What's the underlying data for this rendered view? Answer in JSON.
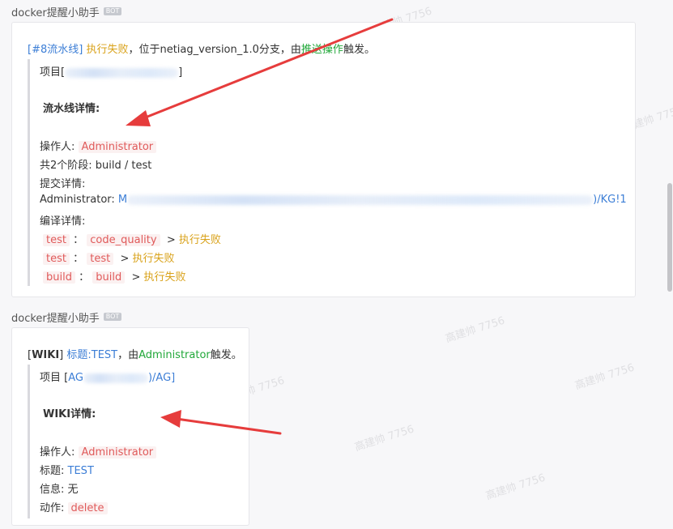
{
  "messages": [
    {
      "sender": "docker提醒小助手",
      "bot_tag": "BOT",
      "header": {
        "link": "[#8流水线]",
        "status": "执行失败",
        "text1": "，位于netiag_version_1.0分支，由",
        "trigger": "推送操作",
        "text2": "触发。"
      },
      "project_label": "项目",
      "project_bracket_open": "[",
      "project_visible_tail": "]",
      "section_title": "流水线详情:",
      "operator_label": "操作人:",
      "operator_value": "Administrator",
      "stages_text": "共2个阶段: build / test",
      "commit_label": "提交详情:",
      "commit_author": "Administrator:",
      "commit_head": "M",
      "commit_tail": ")/KG!1",
      "compile_label": "编译详情:",
      "compile_rows": [
        {
          "stage": "test",
          "sep": "：",
          "job": "code_quality",
          "arrow": ">",
          "result": "执行失败"
        },
        {
          "stage": "test",
          "sep": "：",
          "job": "test",
          "arrow": ">",
          "result": "执行失败"
        },
        {
          "stage": "build",
          "sep": "：",
          "job": "build",
          "arrow": ">",
          "result": "执行失败"
        }
      ]
    },
    {
      "sender": "docker提醒小助手",
      "bot_tag": "BOT",
      "header": {
        "open": "[",
        "tag": "WIKI",
        "close": "]",
        "title_link": "标题:TEST",
        "text1": "，由",
        "author": "Administrator",
        "text2": "触发。"
      },
      "project_label": "项目",
      "project_bracket_open": "[",
      "project_head": "AG",
      "project_tail": ")/AG]",
      "section_title": "WIKI详情:",
      "operator_label": "操作人:",
      "operator_value": "Administrator",
      "title_label": "标题:",
      "title_value": "TEST",
      "info_label": "信息:",
      "info_value": "无",
      "action_label": "动作:",
      "action_value": "delete"
    }
  ],
  "watermark_text": "高建帅 7756",
  "colors": {
    "link": "#3c7ed6",
    "fail": "#d9a21a",
    "success": "#22a83a",
    "code": "#e05a5a",
    "arrow": "#e63c3c"
  }
}
